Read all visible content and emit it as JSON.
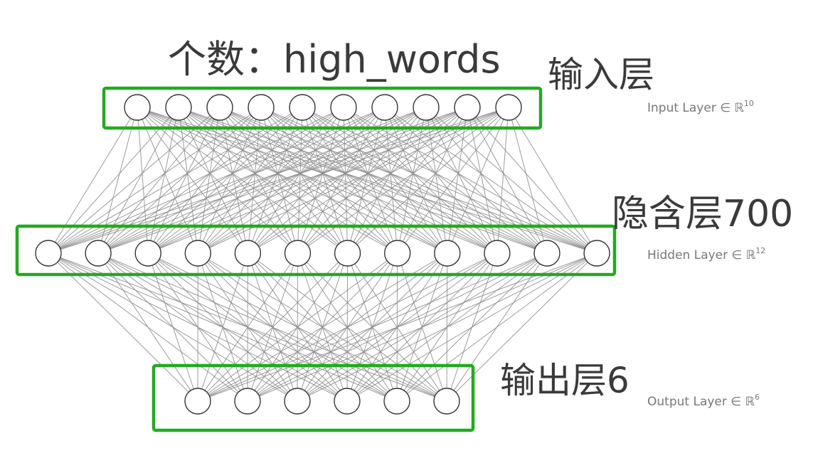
{
  "annotations": {
    "count_label": "个数：high_words",
    "input_layer_title": "输入层",
    "hidden_layer_title": "隐含层700",
    "output_layer_title": "输出层6"
  },
  "layer_labels": {
    "input": {
      "prefix": "Input Layer ∈ ℝ",
      "exponent": "10"
    },
    "hidden": {
      "prefix": "Hidden Layer ∈ ℝ",
      "exponent": "12"
    },
    "output": {
      "prefix": "Output Layer ∈ ℝ",
      "exponent": "6"
    }
  },
  "network": {
    "layers": [
      {
        "name": "input",
        "nodes": 10
      },
      {
        "name": "hidden",
        "nodes": 12
      },
      {
        "name": "output",
        "nodes": 6
      }
    ],
    "fully_connected": true
  },
  "colors": {
    "highlight_box": "#22aa22",
    "edge": "#8a8a8a",
    "node_stroke": "#333333"
  }
}
